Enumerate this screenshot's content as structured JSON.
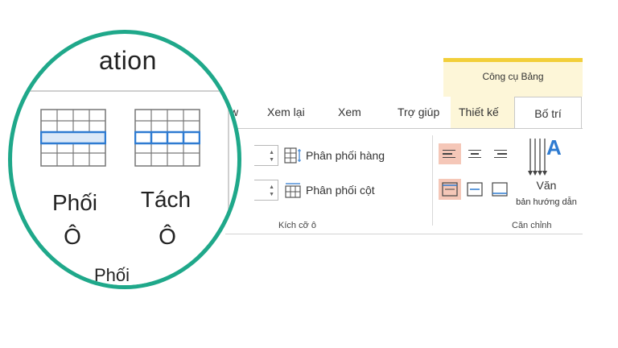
{
  "ribbon": {
    "contextual_label": "Công cụ Bảng",
    "tabs": {
      "view_partial": "w",
      "review": "Xem lại",
      "view": "Xem",
      "help": "Trợ giúp",
      "design": "Thiết kế",
      "layout": "Bố trí"
    },
    "cell_size": {
      "distribute_rows": "Phân phối hàng",
      "distribute_columns": "Phân phối cột",
      "group_label": "Kích cỡ ô"
    },
    "alignment": {
      "text_direction_label": "Văn",
      "text_direction_sub": "bản hướng dẫn",
      "group_label": "Căn chỉnh"
    }
  },
  "magnifier": {
    "title_partial": "ation",
    "merge_cells_line1": "Phối",
    "merge_cells_line2": "Ô",
    "split_cells_line1": "Tách",
    "split_cells_line2": "Ô",
    "group_label": "Phối"
  },
  "colors": {
    "accent_ring": "#1fa88a",
    "contextual_band": "#f2cf3a",
    "selected_button": "#f5c7b8",
    "icon_blue": "#2e7bd1"
  }
}
